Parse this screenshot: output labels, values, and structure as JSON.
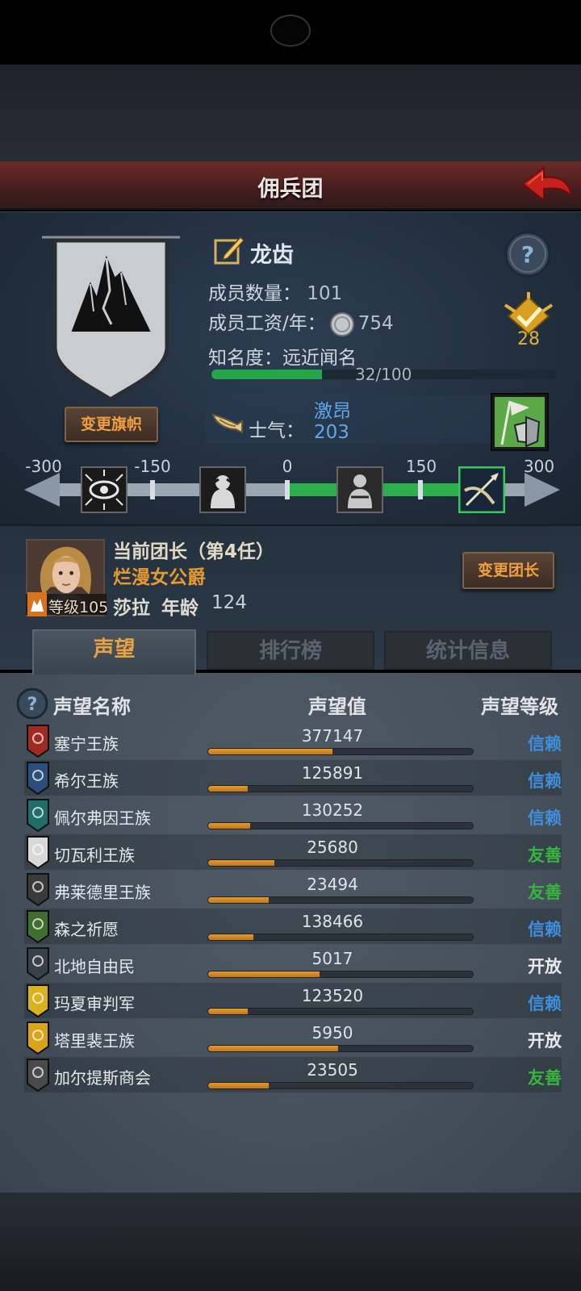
{
  "header": {
    "title": "佣兵团"
  },
  "company": {
    "name": "龙齿",
    "members_label": "成员数量：",
    "members_value": "101",
    "wage_label": "成员工资/年：",
    "wage_value": "754",
    "fame_label": "知名度：",
    "fame_status": "远近闻名",
    "fame_progress": "32/100",
    "fame_fraction": 0.32,
    "rank_value": "28",
    "change_banner_label": "变更旗帜"
  },
  "morale": {
    "label": "士气：",
    "status": "激昂",
    "value": "203",
    "scale_labels": [
      "-300",
      "-150",
      "0",
      "150",
      "300"
    ]
  },
  "leader": {
    "heading": "当前团长（第4任）",
    "title": "烂漫女公爵",
    "name": "莎拉",
    "age_label": "年龄",
    "age": "124",
    "level": "等级105",
    "change_leader_label": "变更团长"
  },
  "tabs": [
    {
      "label": "声望"
    },
    {
      "label": "排行榜"
    },
    {
      "label": "统计信息"
    }
  ],
  "reputation": {
    "col_name": "声望名称",
    "col_value": "声望值",
    "col_level": "声望等级",
    "rows": [
      {
        "name": "塞宁王族",
        "value": "377147",
        "fill": 0.47,
        "level": "信赖",
        "level_color": "#3f8fe0",
        "icon_color": "#a02a22"
      },
      {
        "name": "希尔王族",
        "value": "125891",
        "fill": 0.15,
        "level": "信赖",
        "level_color": "#3f8fe0",
        "icon_color": "#2a4f7a"
      },
      {
        "name": "佩尔弗因王族",
        "value": "130252",
        "fill": 0.16,
        "level": "信赖",
        "level_color": "#3f8fe0",
        "icon_color": "#1f6e6a"
      },
      {
        "name": "切瓦利王族",
        "value": "25680",
        "fill": 0.25,
        "level": "友善",
        "level_color": "#37b53f",
        "icon_color": "#d8d8d8"
      },
      {
        "name": "弗莱德里王族",
        "value": "23494",
        "fill": 0.23,
        "level": "友善",
        "level_color": "#37b53f",
        "icon_color": "#3a3a3a"
      },
      {
        "name": "森之祈愿",
        "value": "138466",
        "fill": 0.17,
        "level": "信赖",
        "level_color": "#3f8fe0",
        "icon_color": "#3f6e2e"
      },
      {
        "name": "北地自由民",
        "value": "5017",
        "fill": 0.42,
        "level": "开放",
        "level_color": "#e8eaec",
        "icon_color": "#3a4048"
      },
      {
        "name": "玛夏审判军",
        "value": "123520",
        "fill": 0.15,
        "level": "信赖",
        "level_color": "#3f8fe0",
        "icon_color": "#d9b21e"
      },
      {
        "name": "塔里裴王族",
        "value": "5950",
        "fill": 0.49,
        "level": "开放",
        "level_color": "#e8eaec",
        "icon_color": "#d9a419"
      },
      {
        "name": "加尔提斯商会",
        "value": "23505",
        "fill": 0.23,
        "level": "友善",
        "level_color": "#37b53f",
        "icon_color": "#4a4a4a"
      }
    ]
  },
  "colors": {
    "accent_orange": "#e39a32",
    "accent_blue": "#5fa8ea",
    "fame_green": "#26a64a",
    "title_red": "#6b2a28"
  }
}
